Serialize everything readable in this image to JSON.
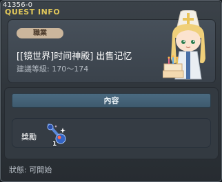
{
  "header": {
    "quest_id": "41356-0",
    "title": "QUEST INFO"
  },
  "npc_card": {
    "badge_label": "職業",
    "quest_name": "[[镜世界]时间神殿] 出售记忆",
    "level_text": "建議等級: 170～174"
  },
  "content": {
    "tab_label": "內容",
    "reward_label": "獎勵",
    "reward_item_icon": "mystic-orb-icon",
    "reward_count": "1"
  },
  "status": {
    "text": "狀態: 可開始"
  },
  "colors": {
    "title_gold": "#e0c75a",
    "badge_bg": "#cbb69c",
    "tab_bg": "#3e5a6e"
  }
}
